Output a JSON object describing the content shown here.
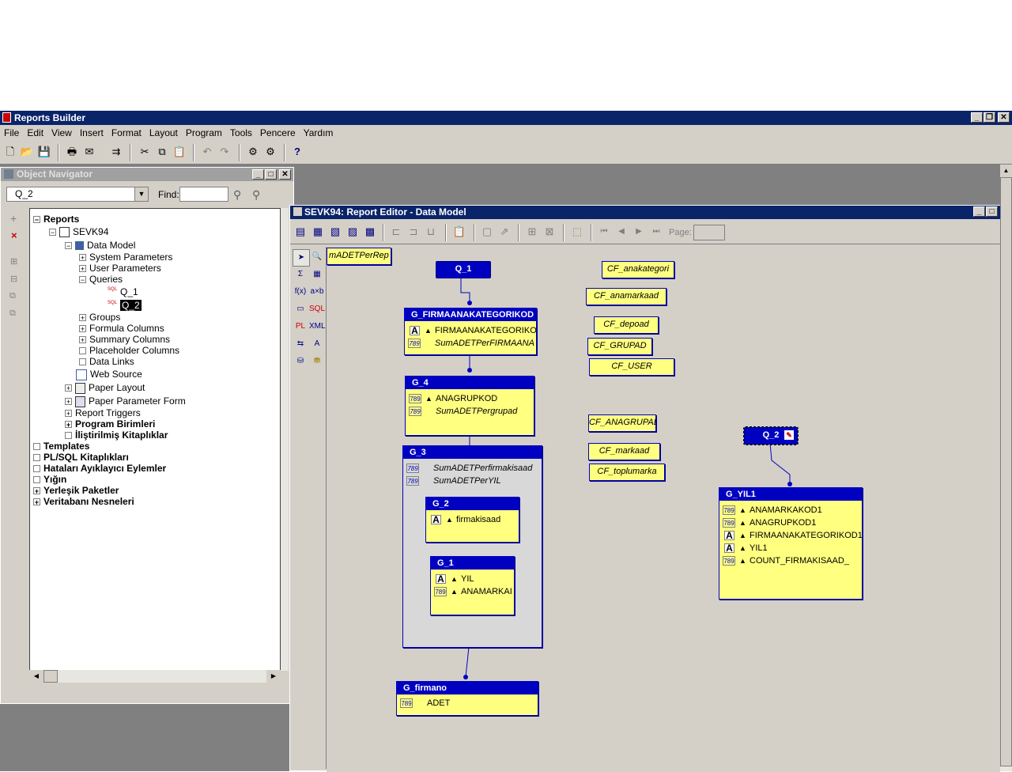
{
  "app": {
    "title": "Reports Builder"
  },
  "menu": [
    "File",
    "Edit",
    "View",
    "Insert",
    "Format",
    "Layout",
    "Program",
    "Tools",
    "Pencere",
    "Yardım"
  ],
  "navigator": {
    "title": "Object Navigator",
    "selected_value": "Q_2",
    "find_label": "Find:",
    "find_value": "",
    "tree": [
      {
        "label": "Reports",
        "bold": true
      },
      {
        "label": "SEVK94"
      },
      {
        "label": "Data Model"
      },
      {
        "label": "System Parameters"
      },
      {
        "label": "User Parameters"
      },
      {
        "label": "Queries"
      },
      {
        "label": "Q_1"
      },
      {
        "label": "Q_2"
      },
      {
        "label": "Groups"
      },
      {
        "label": "Formula Columns"
      },
      {
        "label": "Summary Columns"
      },
      {
        "label": "Placeholder Columns"
      },
      {
        "label": "Data Links"
      },
      {
        "label": "Web Source"
      },
      {
        "label": "Paper Layout"
      },
      {
        "label": "Paper Parameter Form"
      },
      {
        "label": "Report Triggers"
      },
      {
        "label": "Program Birimleri",
        "bold": true
      },
      {
        "label": "İliştirilmiş Kitaplıklar",
        "bold": true
      },
      {
        "label": "Templates",
        "bold": true
      },
      {
        "label": "PL/SQL Kitaplıkları",
        "bold": true
      },
      {
        "label": "Hataları Ayıklayıcı Eylemler",
        "bold": true
      },
      {
        "label": "Yığın",
        "bold": true
      },
      {
        "label": "Yerleşik Paketler",
        "bold": true
      },
      {
        "label": "Veritabanı Nesneleri",
        "bold": true
      }
    ]
  },
  "editor": {
    "title": "SEVK94: Report Editor - Data Model",
    "page_label": "Page:",
    "page_value": "",
    "partial_label": "mADETPerRep",
    "queries": {
      "q1": "Q_1",
      "q2": "Q_2"
    },
    "groups": {
      "g_firma": {
        "title": "G_FIRMAANAKATEGORIKOD",
        "rows": [
          {
            "type": "A",
            "name": "FIRMAANAKATEGORIKOI",
            "italic": false
          },
          {
            "type": "89",
            "name": "SumADETPerFIRMAANA",
            "italic": true
          }
        ]
      },
      "g_4": {
        "title": "G_4",
        "rows": [
          {
            "type": "89",
            "name": "ANAGRUPKOD",
            "italic": false
          },
          {
            "type": "89",
            "name": "SumADETPergrupad",
            "italic": true
          }
        ]
      },
      "g_3": {
        "title": "G_3",
        "rows": [
          {
            "type": "89",
            "name": "SumADETPerfirmakisaad",
            "italic": true
          },
          {
            "type": "89",
            "name": "SumADETPerYIL",
            "italic": true
          }
        ]
      },
      "g_2": {
        "title": "G_2",
        "rows": [
          {
            "type": "A",
            "name": "firmakisaad",
            "italic": false
          }
        ]
      },
      "g_1": {
        "title": "G_1",
        "rows": [
          {
            "type": "A",
            "name": "YIL",
            "italic": false
          },
          {
            "type": "89",
            "name": "ANAMARKAI",
            "italic": false
          }
        ]
      },
      "g_firmano": {
        "title": "G_firmano",
        "rows": [
          {
            "type": "89",
            "name": "ADET",
            "italic": false
          }
        ]
      },
      "g_yil1": {
        "title": "G_YIL1",
        "rows": [
          {
            "type": "89",
            "name": "ANAMARKAKOD1",
            "italic": false
          },
          {
            "type": "89",
            "name": "ANAGRUPKOD1",
            "italic": false
          },
          {
            "type": "A",
            "name": "FIRMAANAKATEGORIKOD1",
            "italic": false
          },
          {
            "type": "A",
            "name": "YIL1",
            "italic": false
          },
          {
            "type": "89",
            "name": "COUNT_FIRMAKISAAD_",
            "italic": false
          }
        ]
      }
    },
    "formula_columns": [
      "CF_anakategori",
      "CF_anamarkaad",
      "CF_depoad",
      "CF_GRUPAD",
      "CF_USER",
      "CF_ANAGRUPAD",
      "CF_markaad",
      "CF_toplumarka"
    ],
    "type_labels": {
      "A": "A",
      "89": "789"
    }
  }
}
